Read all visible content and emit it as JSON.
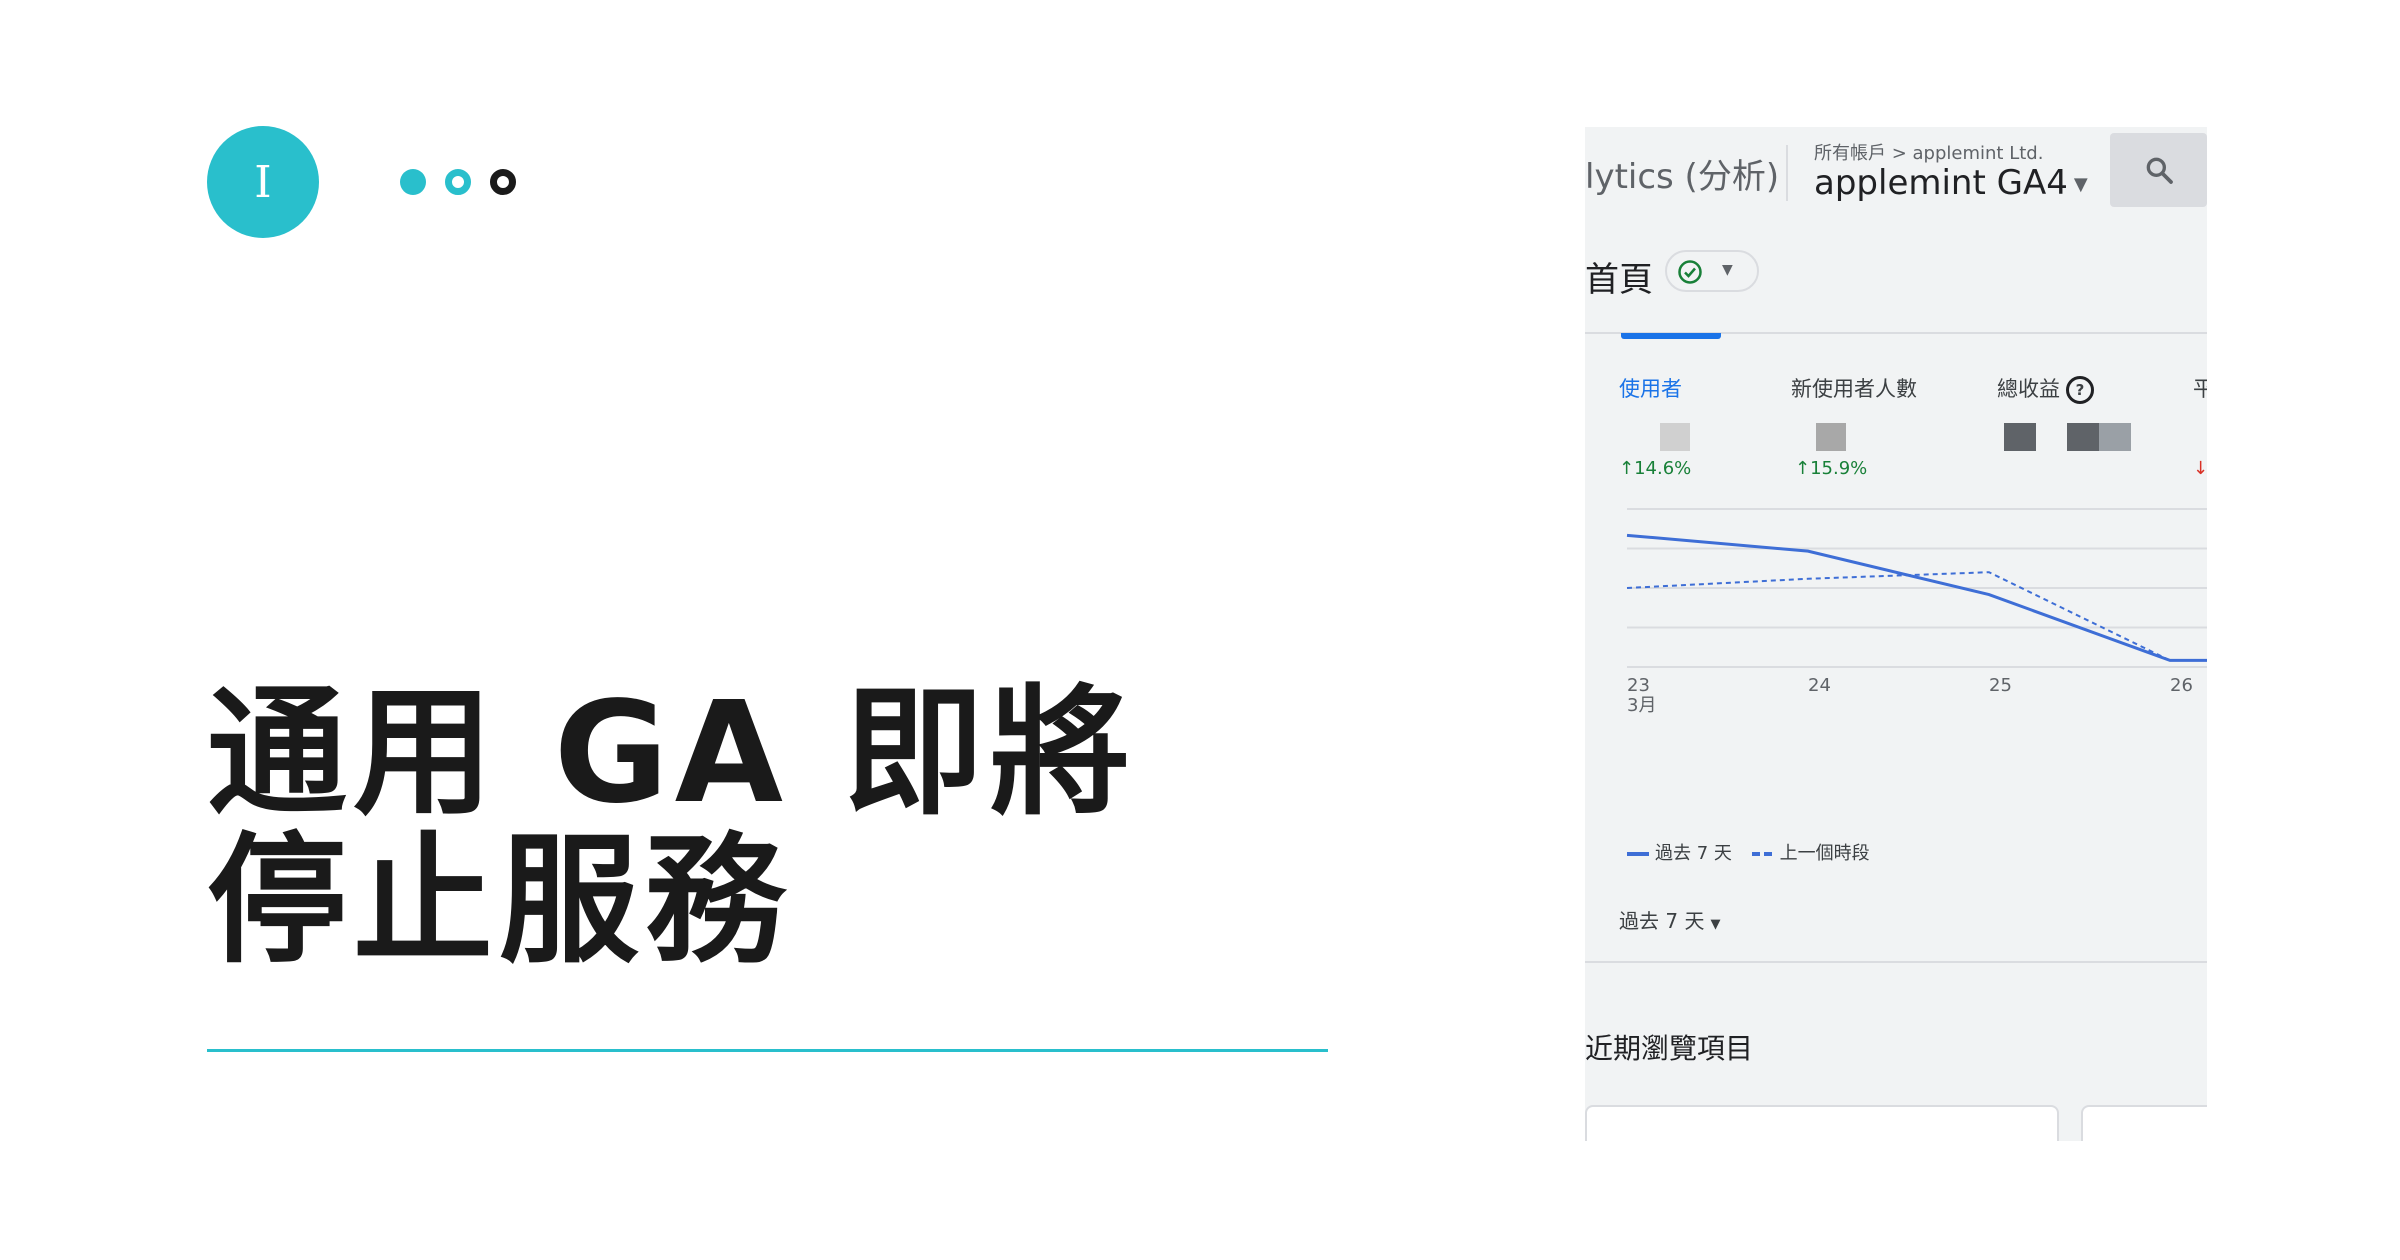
{
  "slide": {
    "badge_label": "I",
    "headline_line1": "通用 GA 即將",
    "headline_line2": "停止服務",
    "accent_color": "#29bfcc"
  },
  "ga": {
    "app_title": "lytics (分析)",
    "breadcrumb": "所有帳戶 > applemint Ltd.",
    "property": "applemint GA4",
    "page_title": "首頁",
    "metrics": [
      {
        "label": "使用者",
        "delta": "↑14.6%"
      },
      {
        "label": "新使用者人數",
        "delta": "↑15.9%"
      },
      {
        "label": "總收益",
        "delta": ""
      },
      {
        "label": "平",
        "delta": "↓"
      }
    ],
    "legend": {
      "current": "過去 7 天",
      "previous": "上一個時段"
    },
    "date_range": "過去 7 天",
    "recent_title": "近期瀏覽項目",
    "brand_color": "#1a73e8"
  },
  "chart_data": {
    "type": "line",
    "x": [
      "23",
      "24",
      "25",
      "26"
    ],
    "x_month_label": "3月",
    "series": [
      {
        "name": "過去 7 天",
        "values": [
          1.0,
          0.88,
          0.55,
          0.05
        ]
      },
      {
        "name": "上一個時段",
        "values": [
          0.6,
          0.67,
          0.72,
          0.05
        ]
      }
    ],
    "ylim": [
      0,
      1.2
    ],
    "grid": true,
    "legend_position": "bottom-left"
  }
}
